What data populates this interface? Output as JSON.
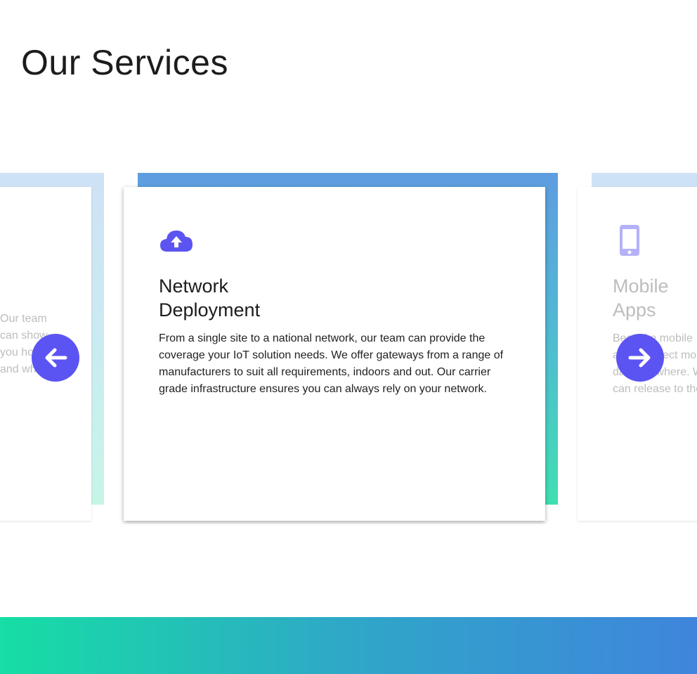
{
  "section": {
    "title": "Our Services"
  },
  "carousel": {
    "prev_card": {
      "title": "",
      "description": "Our team can show you how and wh"
    },
    "active_card": {
      "icon": "cloud-upload-icon",
      "title": "Network Deployment",
      "description": "From a single site to a national network, our team can provide the coverage your IoT solution needs. We offer gateways from a range of manufacturers to suit all requirements, indoors and out. Our carrier grade infrastructure ensures you can always rely on your network."
    },
    "next_card": {
      "icon": "mobile-phone-icon",
      "title": "Mobile Apps",
      "description": "Bespoke mobile apps. Collect more data anywhere. We can release to the p"
    },
    "prev_icon": "arrow-left-icon",
    "next_icon": "arrow-right-icon"
  },
  "colors": {
    "accent": "#5b54f2",
    "gradient_top": "#5e9de0",
    "gradient_bottom": "#40dfb2",
    "footer_left": "#16dea4",
    "footer_right": "#3f85dc"
  }
}
